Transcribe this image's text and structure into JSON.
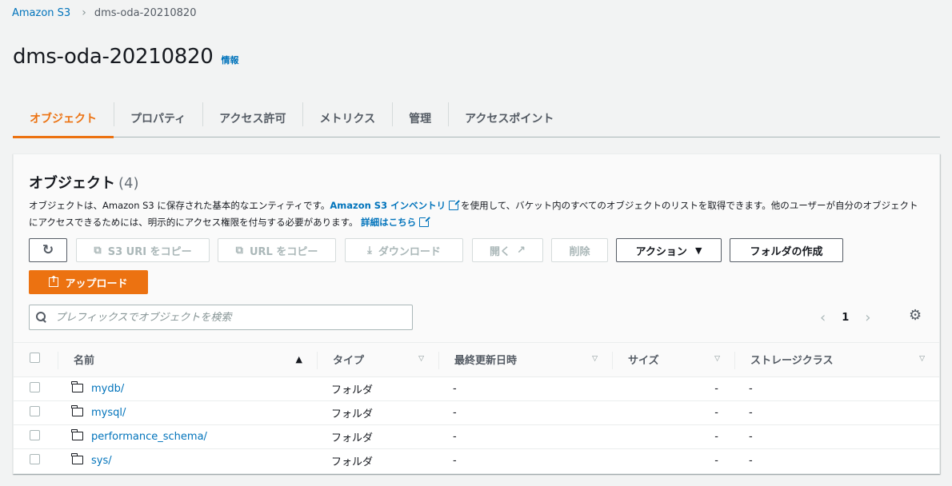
{
  "breadcrumb": {
    "root": "Amazon S3",
    "current": "dms-oda-20210820"
  },
  "page": {
    "title": "dms-oda-20210820",
    "info": "情報"
  },
  "tabs": [
    {
      "label": "オブジェクト",
      "active": true
    },
    {
      "label": "プロパティ"
    },
    {
      "label": "アクセス許可"
    },
    {
      "label": "メトリクス"
    },
    {
      "label": "管理"
    },
    {
      "label": "アクセスポイント"
    }
  ],
  "panel": {
    "title": "オブジェクト",
    "count": "(4)",
    "desc_part1": "オブジェクトは、Amazon S3 に保存された基本的なエンティティです。",
    "desc_link1": "Amazon S3 インベントリ",
    "desc_part2": "を使用して、バケット内のすべてのオブジェクトのリストを取得できます。他のユーザーが自分のオブジェクトにアクセスできるためには、明示的にアクセス権限を付与する必要があります。",
    "desc_link2": "詳細はこちら"
  },
  "toolbar": {
    "copy_s3_uri": "S3 URI をコピー",
    "copy_url": "URL をコピー",
    "download": "ダウンロード",
    "open": "開く",
    "delete": "削除",
    "actions": "アクション",
    "create_folder": "フォルダの作成",
    "upload": "アップロード"
  },
  "search": {
    "placeholder": "プレフィックスでオブジェクトを検索"
  },
  "pagination": {
    "page": "1"
  },
  "table": {
    "columns": [
      "名前",
      "タイプ",
      "最終更新日時",
      "サイズ",
      "ストレージクラス"
    ],
    "rows": [
      {
        "name": "mydb/",
        "type": "フォルダ",
        "modified": "-",
        "size": "-",
        "storage": "-"
      },
      {
        "name": "mysql/",
        "type": "フォルダ",
        "modified": "-",
        "size": "-",
        "storage": "-"
      },
      {
        "name": "performance_schema/",
        "type": "フォルダ",
        "modified": "-",
        "size": "-",
        "storage": "-"
      },
      {
        "name": "sys/",
        "type": "フォルダ",
        "modified": "-",
        "size": "-",
        "storage": "-"
      }
    ]
  },
  "colors": {
    "accent": "#ec7211",
    "link": "#0073bb",
    "text": "#16191f",
    "muted": "#545b64"
  }
}
